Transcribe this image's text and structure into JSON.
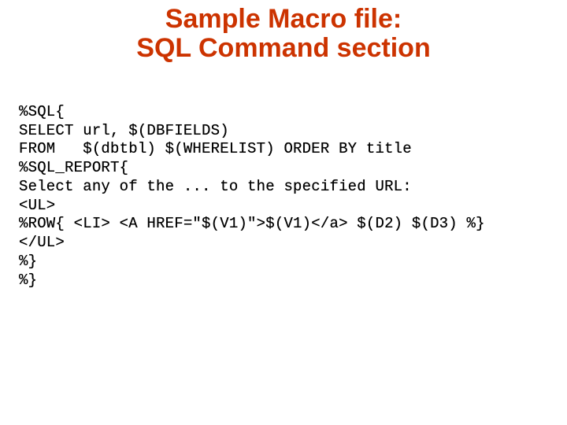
{
  "slide": {
    "title_line1": "Sample Macro file:",
    "title_line2": "SQL Command section"
  },
  "code": {
    "lines": [
      "%SQL{",
      "SELECT url, $(DBFIELDS)",
      "FROM   $(dbtbl) $(WHERELIST) ORDER BY title",
      "%SQL_REPORT{",
      "Select any of the ... to the specified URL:",
      "<UL>",
      "%ROW{ <LI> <A HREF=\"$(V1)\">$(V1)</a> $(D2) $(D3) %}",
      "</UL>",
      "%}",
      "%}"
    ]
  }
}
